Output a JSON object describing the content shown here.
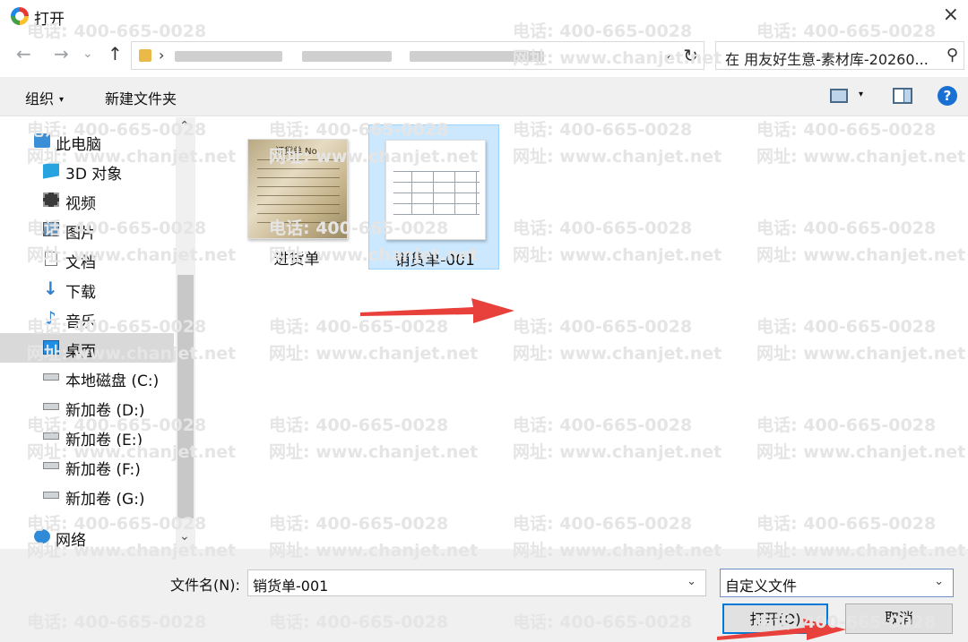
{
  "window": {
    "title": "打开",
    "close_icon": "×"
  },
  "address": {
    "back_icon": "←",
    "forward_icon": "→",
    "history_icon": "⌄",
    "up_icon": "↑",
    "crumb_sep": "›",
    "path_chevron": "⌄",
    "refresh_icon": "↻",
    "search_placeholder": "在 用友好生意-素材库-20260...",
    "search_icon": "⚲"
  },
  "toolbar": {
    "organize_label": "组织",
    "organize_caret": "▾",
    "new_folder_label": "新建文件夹",
    "view_caret": "▾",
    "help_label": "?"
  },
  "nav": {
    "items": [
      {
        "label": "此电脑",
        "icon": "this-pc-icon"
      },
      {
        "label": "3D 对象",
        "icon": "3d-objects-icon"
      },
      {
        "label": "视频",
        "icon": "videos-icon"
      },
      {
        "label": "图片",
        "icon": "pictures-icon"
      },
      {
        "label": "文档",
        "icon": "documents-icon"
      },
      {
        "label": "下载",
        "icon": "downloads-icon"
      },
      {
        "label": "音乐",
        "icon": "music-icon"
      },
      {
        "label": "桌面",
        "icon": "desktop-icon",
        "selected": true
      },
      {
        "label": "本地磁盘 (C:)",
        "icon": "local-disk-icon"
      },
      {
        "label": "新加卷 (D:)",
        "icon": "drive-icon"
      },
      {
        "label": "新加卷 (E:)",
        "icon": "drive-icon"
      },
      {
        "label": "新加卷 (F:)",
        "icon": "drive-icon"
      },
      {
        "label": "新加卷 (G:)",
        "icon": "drive-icon"
      },
      {
        "label": "网络",
        "icon": "network-icon"
      }
    ],
    "scroll_up": "⌃",
    "scroll_down": "⌄"
  },
  "files": [
    {
      "name": "进货单",
      "thumb_title": "订货单 No.",
      "selected": false
    },
    {
      "name": "销货单-001",
      "selected": true
    }
  ],
  "bottom": {
    "filename_label": "文件名(N):",
    "filename_value": "销货单-001",
    "filename_chevron": "⌄",
    "filetype_value": "自定义文件",
    "filetype_chevron": "⌄",
    "open_label": "打开(O)",
    "cancel_label": "取消"
  },
  "watermark": {
    "phone": "电话: 400-665-0028",
    "site": "网址: www.chanjet.net"
  },
  "colors": {
    "accent": "#0078d7",
    "selection": "#cce8ff",
    "arrow": "#e8403a"
  }
}
